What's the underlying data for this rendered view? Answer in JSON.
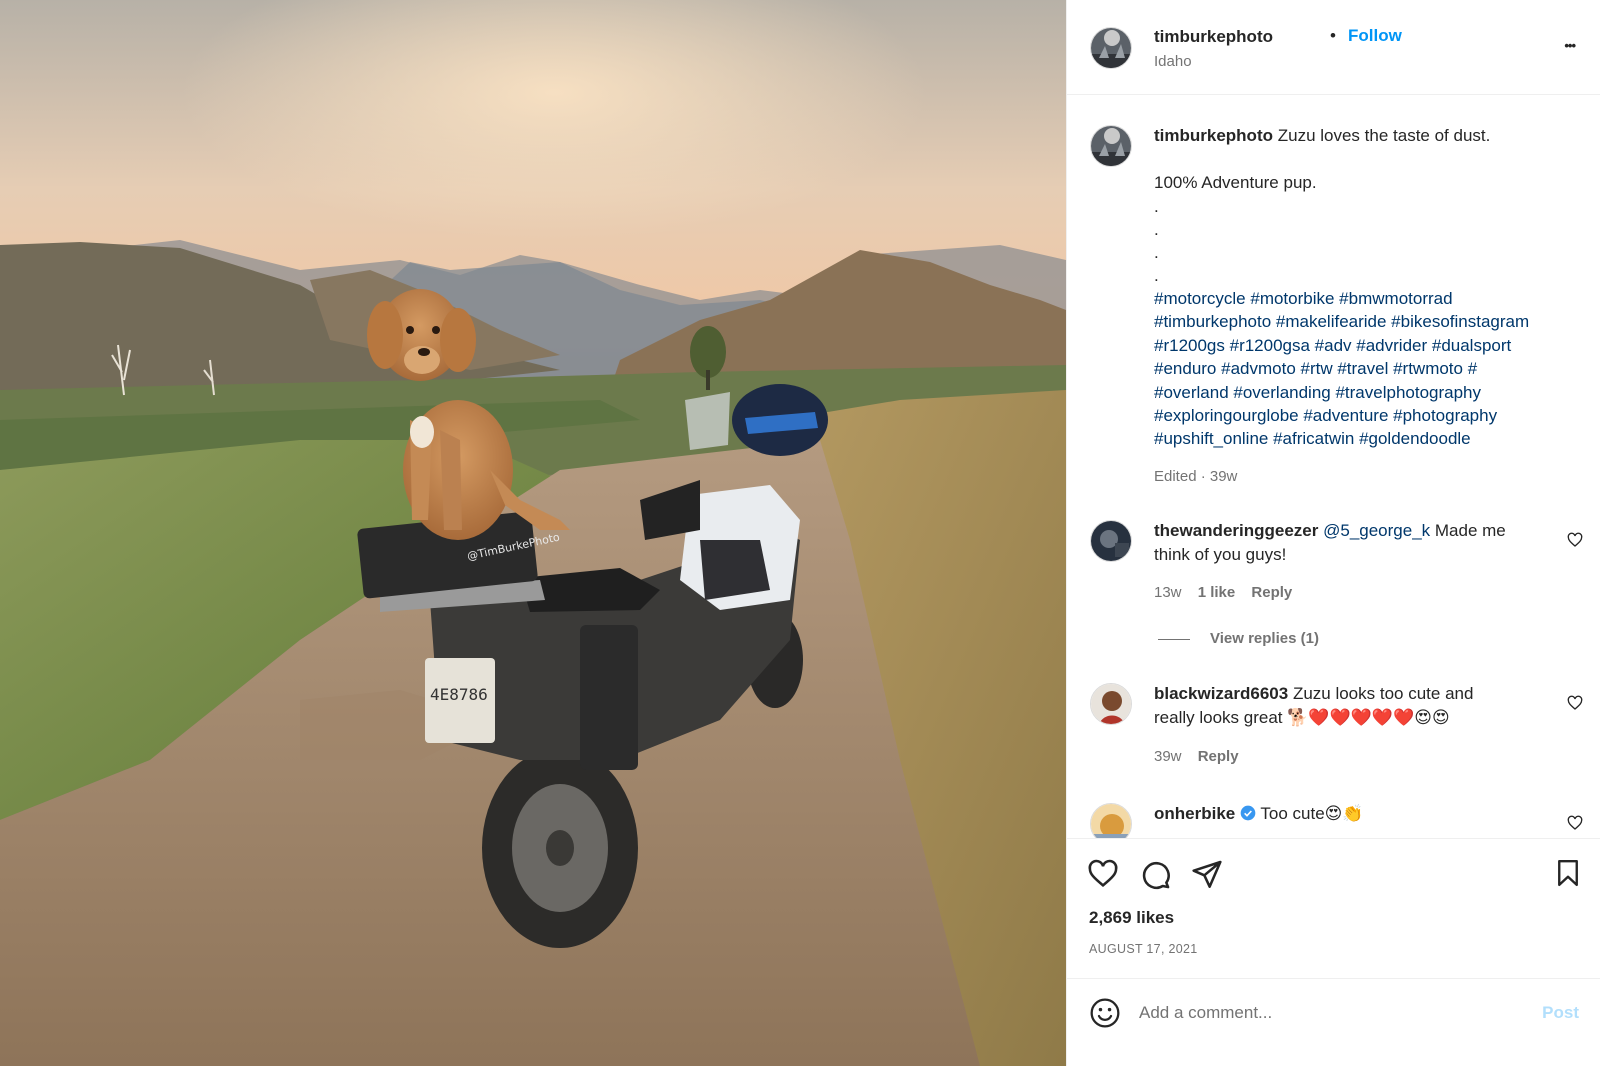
{
  "post": {
    "username": "timburkephoto",
    "follow_label": "Follow",
    "separator": "•",
    "location": "Idaho",
    "more_label": "•••"
  },
  "caption": {
    "username": "timburkephoto",
    "line1": "Zuzu loves the taste of dust.",
    "line2": "100% Adventure pup.",
    "dots": [
      ".",
      ".",
      ".",
      "."
    ],
    "hashtags": [
      "#motorcycle #motorbike #bmwmotorrad",
      "#timburkephoto #makelifearide #bikesofinstagram",
      "#r1200gs #r1200gsa #adv #advrider #dualsport",
      "#enduro #advmoto #rtw #travel #rtwmoto #",
      "#overland #overlanding #travelphotography",
      "#exploringourglobe #adventure #photography",
      "#upshift_online #africatwin #goldendoodle"
    ],
    "edited": "Edited · 39w"
  },
  "comments": [
    {
      "username": "thewanderinggeezer",
      "mention": "@5_george_k",
      "text_a": " Made me",
      "text_b": "think of you guys!",
      "time": "13w",
      "likes": "1 like",
      "reply": "Reply",
      "view_replies": "View replies (1)"
    },
    {
      "username": "blackwizard6603",
      "text_a": "Zuzu looks too cute and",
      "text_b": "really looks great 🐕❤️❤️❤️❤️❤️😍😍",
      "time": "39w",
      "reply": "Reply"
    },
    {
      "username": "onherbike",
      "text_a": "Too cute😍👏"
    }
  ],
  "photo": {
    "case_label": "@TimBurkePhoto",
    "plate": "4E8786"
  },
  "actions": {
    "likes": "2,869 likes",
    "date": "AUGUST 17, 2021"
  },
  "add_comment": {
    "placeholder": "Add a comment...",
    "post_label": "Post"
  },
  "colors": {
    "link_blue": "#0095f6",
    "hashtag_blue": "#00376b",
    "verified_blue": "#3897f0",
    "muted": "#737373"
  }
}
